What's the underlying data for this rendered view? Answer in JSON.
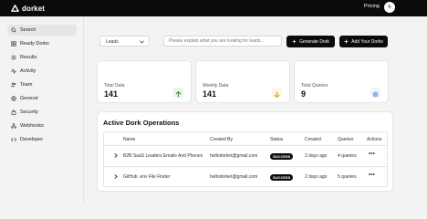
{
  "app": {
    "name": "dorket",
    "pricing_label": "Pricing",
    "avatar_initial": "h"
  },
  "sidebar": {
    "items": [
      {
        "label": "Search",
        "icon": "search-icon",
        "active": true
      },
      {
        "label": "Ready Dorks",
        "icon": "grid-icon"
      },
      {
        "label": "Results",
        "icon": "list-icon"
      },
      {
        "label": "Activity",
        "icon": "activity-icon"
      },
      {
        "label": "Team",
        "icon": "users-icon"
      },
      {
        "label": "General",
        "icon": "globe-icon"
      },
      {
        "label": "Security",
        "icon": "lock-icon"
      },
      {
        "label": "Webhooks",
        "icon": "webhook-icon"
      },
      {
        "label": "Developer",
        "icon": "code-icon"
      }
    ]
  },
  "search": {
    "category_value": "Leads",
    "placeholder": "Please explain what you are looking for leads...",
    "generate_label": "Generate Dork",
    "add_label": "Add Your Dorks"
  },
  "stats": [
    {
      "label": "Total Data",
      "value": "141",
      "icon": "arrow-up-icon",
      "accent": "#e7f6ea",
      "icon_color": "#2f9e44"
    },
    {
      "label": "Weekly Data",
      "value": "141",
      "icon": "arrow-down-icon",
      "accent": "#fdf6e3",
      "icon_color": "#d4a514"
    },
    {
      "label": "Total Queries",
      "value": "9",
      "icon": "circle-icon",
      "accent": "#eef3fb",
      "icon_color": "#8fb3e6"
    }
  ],
  "operations": {
    "title": "Active Dork Operations",
    "columns": [
      "Name",
      "Created By",
      "Status",
      "Created",
      "Queries",
      "Actions"
    ],
    "rows": [
      {
        "name": "B2B SaaS Leaders Emails And Phones",
        "created_by": "hellodorket@gmail.com",
        "status": "SUCCESS",
        "created": "2 days ago",
        "queries": "4 queries"
      },
      {
        "name": "GitHub .env File Finder",
        "created_by": "hellodorket@gmail.com",
        "status": "SUCCESS",
        "created": "2 days ago",
        "queries": "5 queries"
      }
    ]
  }
}
